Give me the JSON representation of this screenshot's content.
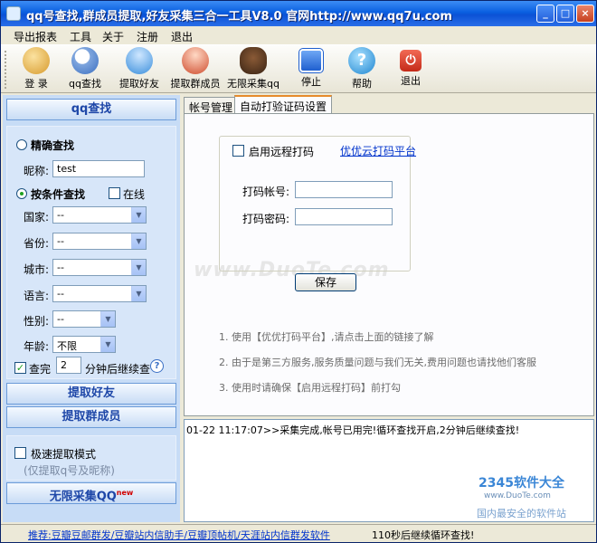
{
  "window": {
    "title": "qq号查找,群成员提取,好友采集三合一工具V8.0 官网http://www.qq7u.com",
    "controls": [
      "_",
      "□",
      "×"
    ]
  },
  "menu": [
    "导出报表",
    "工具",
    "关于",
    "注册",
    "退出"
  ],
  "toolbar": [
    {
      "label": "登 录",
      "icon": "users-login-icon",
      "color": "#e0a53a"
    },
    {
      "label": "qq查找",
      "icon": "magnifier-icon",
      "color": "#5a8fd6"
    },
    {
      "label": "提取好友",
      "icon": "user-icon",
      "color": "#4a9be0"
    },
    {
      "label": "提取群成员",
      "icon": "group-icon",
      "color": "#d6533a"
    },
    {
      "label": "无限采集qq",
      "icon": "bug-icon",
      "color": "#5a3a22"
    },
    {
      "label": "停止",
      "icon": "stop-icon",
      "color": "#2a6fd6"
    },
    {
      "label": "帮助",
      "icon": "help-icon",
      "color": "#2a8fd6"
    },
    {
      "label": "退出",
      "icon": "power-icon",
      "color": "#d63a2a"
    }
  ],
  "left": {
    "qq_search_btn": "qq查找",
    "exact_search": "精确查找",
    "nickname_label": "昵称:",
    "nickname_value": "test",
    "condition_search": "按条件查找",
    "online_label": "在线",
    "country_label": "国家:",
    "country_value": "--",
    "province_label": "省份:",
    "province_value": "--",
    "city_label": "城市:",
    "city_value": "--",
    "language_label": "语言:",
    "language_value": "--",
    "gender_label": "性别:",
    "gender_value": "--",
    "age_label": "年龄:",
    "age_value": "不限",
    "finish_label": "查完",
    "finish_minutes": "2",
    "finish_suffix": "分钟后继续查",
    "extract_friends_btn": "提取好友",
    "extract_members_btn": "提取群成员",
    "fast_mode_label": "极速提取模式",
    "fast_mode_hint": "(仅提取q号及昵称)",
    "unlimited_btn": "无限采集QQ",
    "unlimited_badge": "new"
  },
  "tabs": [
    "帐号管理",
    "自动打验证码设置"
  ],
  "captcha": {
    "enable_label": "启用远程打码",
    "platform_link": "优优云打码平台",
    "account_label": "打码帐号:",
    "account_value": "",
    "password_label": "打码密码:",
    "password_value": "",
    "save_btn": "保存",
    "notes": [
      "1. 使用【优优打码平台】,请点击上面的链接了解",
      "2. 由于是第三方服务,服务质量问题与我们无关,费用问题也请找他们客服",
      "3. 使用时请确保【启用远程打码】前打勾"
    ],
    "watermark": "www.DuoTe.com"
  },
  "log": {
    "line": "01-22 11:17:07>>采集完成,帐号已用完!循环查找开启,2分钟后继续查找!"
  },
  "status": {
    "promo": "推荐:豆瓣豆邮群发/豆瓣站内信助手/豆瓣顶帖机/天涯站内信群发软件",
    "message": "110秒后继续循环查找!"
  },
  "brand": {
    "logo_text": "2345软件大全",
    "url": "www.DuoTe.com",
    "slogan": "国内最安全的软件站"
  }
}
